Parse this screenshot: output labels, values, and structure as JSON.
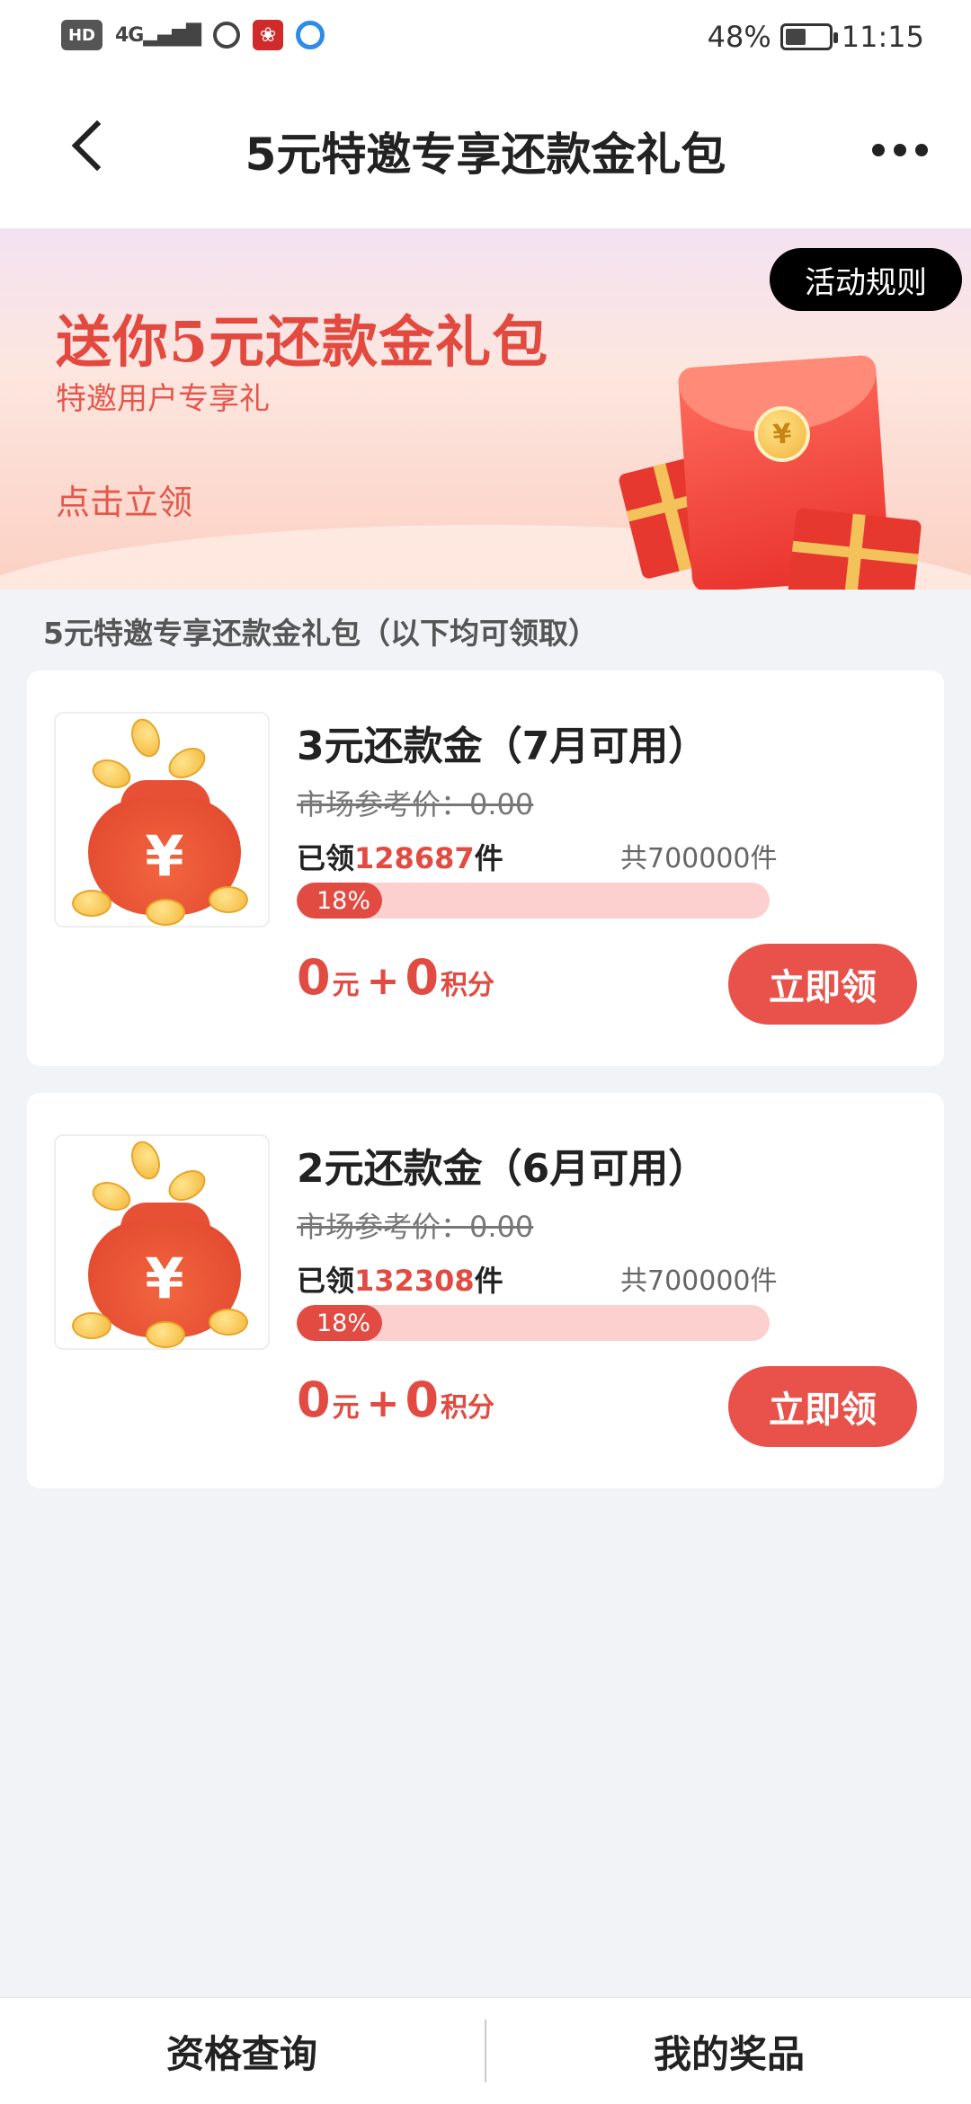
{
  "status_bar": {
    "hd": "HD",
    "network": "4G",
    "battery": "48%",
    "battery_level": 0.48,
    "time": "11:15"
  },
  "header": {
    "title": "5元特邀专享还款金礼包"
  },
  "banner": {
    "rules_button": "活动规则",
    "title": "送你5元还款金礼包",
    "subtitle": "特邀用户专享礼",
    "cta": "点击立领"
  },
  "section": {
    "caption": "5元特邀专享还款金礼包（以下均可领取）"
  },
  "items": [
    {
      "title": "3元还款金（7月可用）",
      "market_price": "市场参考价：0.00",
      "claimed_prefix": "已领",
      "claimed_count": "128687",
      "claimed_suffix": "件",
      "total": "共700000件",
      "progress_label": "18%",
      "progress": 0.18,
      "price_yuan": "0",
      "yuan_unit": "元",
      "plus": "+",
      "price_points": "0",
      "points_unit": "积分",
      "button": "立即领"
    },
    {
      "title": "2元还款金（6月可用）",
      "market_price": "市场参考价：0.00",
      "claimed_prefix": "已领",
      "claimed_count": "132308",
      "claimed_suffix": "件",
      "total": "共700000件",
      "progress_label": "18%",
      "progress": 0.18,
      "price_yuan": "0",
      "yuan_unit": "元",
      "plus": "+",
      "price_points": "0",
      "points_unit": "积分",
      "button": "立即领"
    }
  ],
  "bottom_bar": {
    "left": "资格查询",
    "right": "我的奖品"
  }
}
